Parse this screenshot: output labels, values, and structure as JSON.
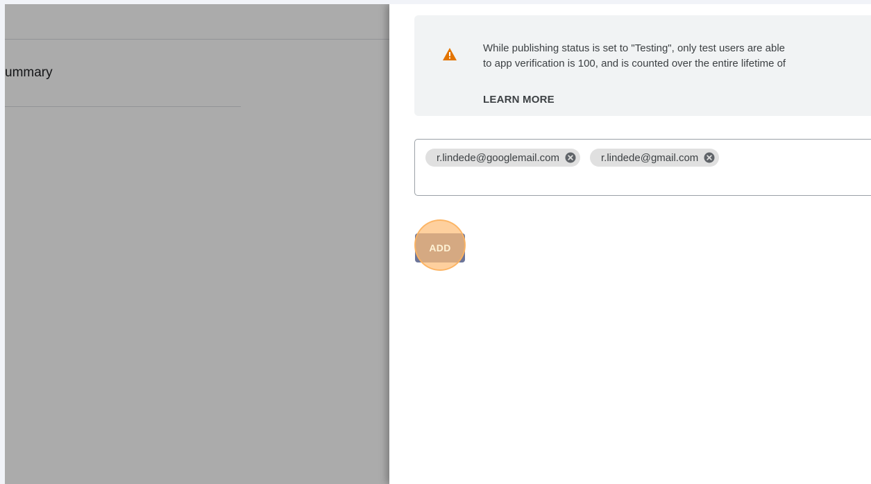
{
  "background_page": {
    "summary_label": "ummary"
  },
  "notice": {
    "line1": "While publishing status is set to \"Testing\", only test users are able",
    "line2": "to app verification is 100, and is counted over the entire lifetime of",
    "learn_more": "LEARN MORE",
    "icon": "warning-icon",
    "icon_color": "#e37400"
  },
  "test_users": {
    "chips": [
      {
        "email": "r.lindede@googlemail.com"
      },
      {
        "email": "r.lindede@gmail.com"
      }
    ],
    "remove_icon": "cancel-circle-icon"
  },
  "actions": {
    "add_label": "ADD",
    "add_color": "#1a73e8",
    "highlight_color": "#fbbc6e"
  }
}
